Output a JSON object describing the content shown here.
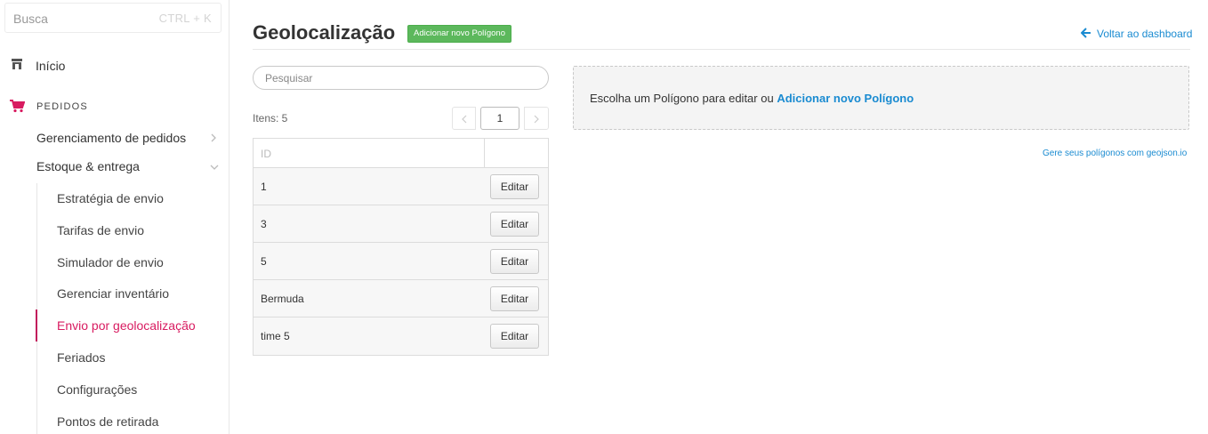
{
  "sidebar": {
    "search": {
      "placeholder": "Busca",
      "shortcut": "CTRL + K"
    },
    "inicio": {
      "label": "Início",
      "icon": "store-icon"
    },
    "pedidos": {
      "label": "PEDIDOS",
      "icon": "cart-icon",
      "icon_color": "#d81b60"
    },
    "sub_items": [
      {
        "label": "Gerenciamento de pedidos",
        "chevron": "chevron-right-icon"
      },
      {
        "label": "Estoque & entrega",
        "chevron": "chevron-down-icon"
      }
    ],
    "estoque_items": [
      {
        "label": "Estratégia de envio",
        "active": false
      },
      {
        "label": "Tarifas de envio",
        "active": false
      },
      {
        "label": "Simulador de envio",
        "active": false
      },
      {
        "label": "Gerenciar inventário",
        "active": false
      },
      {
        "label": "Envio por geolocalização",
        "active": true
      },
      {
        "label": "Feriados",
        "active": false
      },
      {
        "label": "Configurações",
        "active": false
      },
      {
        "label": "Pontos de retirada",
        "active": false
      }
    ],
    "active_color": "#d81b60"
  },
  "header": {
    "title": "Geolocalização",
    "add_badge": "Adicionar novo Polígono",
    "back_link": "Voltar ao dashboard",
    "accent": "#1a8bd1",
    "badge_color": "#5cb85c"
  },
  "list": {
    "search_placeholder": "Pesquisar",
    "items_count": "Itens: 5",
    "current_page": "1",
    "column_id": "ID",
    "rows": [
      {
        "id": "1",
        "action": "Editar"
      },
      {
        "id": "3",
        "action": "Editar"
      },
      {
        "id": "5",
        "action": "Editar"
      },
      {
        "id": "Bermuda",
        "action": "Editar"
      },
      {
        "id": "time 5",
        "action": "Editar"
      }
    ]
  },
  "panel": {
    "text": "Escolha um Polígono para editar ou",
    "link": "Adicionar novo Polígono"
  },
  "geojson_link": "Gere seus polígonos com geojson.io"
}
